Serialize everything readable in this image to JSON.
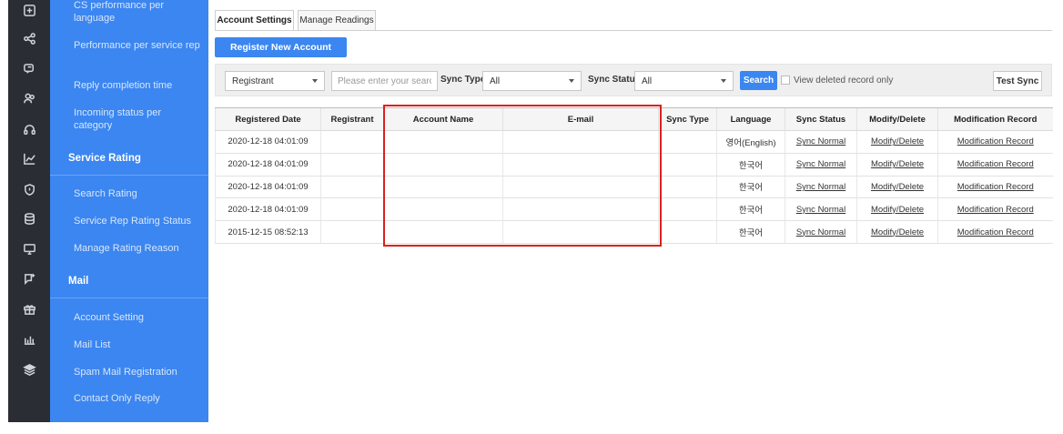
{
  "rail": {
    "icons": [
      "plus-square-icon",
      "share-icon",
      "chat-icon",
      "users-icon",
      "headset-icon",
      "line-chart-icon",
      "shield-icon",
      "database-icon",
      "monitor-icon",
      "message-plus-icon",
      "gift-icon",
      "bar-chart-icon",
      "layers-icon"
    ]
  },
  "menu": {
    "items": {
      "cs_language": "CS performance per language",
      "per_rep": "Performance per service rep",
      "reply_time": "Reply completion time",
      "incoming": "Incoming status per category",
      "service_rating_head": "Service Rating",
      "search_rating": "Search Rating",
      "rep_rating_status": "Service Rep Rating Status",
      "rating_reason": "Manage Rating Reason",
      "mail_head": "Mail",
      "account_setting": "Account Setting",
      "mail_list": "Mail List",
      "spam_registration": "Spam Mail Registration",
      "contact_reply": "Contact Only Reply"
    }
  },
  "tabs": [
    "Account Settings",
    "Manage Readings"
  ],
  "toolbar": {
    "register_label": "Register New Account"
  },
  "filters": {
    "registrant_select": "Registrant",
    "search_placeholder": "Please enter your search",
    "sync_type_label": "Sync Type",
    "sync_type_value": "All",
    "sync_status_label": "Sync Status",
    "sync_status_value": "All",
    "search_button": "Search",
    "deleted_only_label": "View deleted record only",
    "test_sync_button": "Test Sync"
  },
  "table": {
    "headers": [
      "Registered Date",
      "Registrant",
      "Account Name",
      "E-mail",
      "Sync Type",
      "Language",
      "Sync Status",
      "Modify/Delete",
      "Modification Record"
    ],
    "rows": [
      {
        "date": "2020-12-18 04:01:09",
        "registrant": "",
        "account": "",
        "email": "",
        "sync_type": "",
        "language": "영어(English)",
        "sync_status": "Sync Normal",
        "modify": "Modify/Delete",
        "record": "Modification Record"
      },
      {
        "date": "2020-12-18 04:01:09",
        "registrant": "",
        "account": "",
        "email": "",
        "sync_type": "",
        "language": "한국어",
        "sync_status": "Sync Normal",
        "modify": "Modify/Delete",
        "record": "Modification Record"
      },
      {
        "date": "2020-12-18 04:01:09",
        "registrant": "",
        "account": "",
        "email": "",
        "sync_type": "",
        "language": "한국어",
        "sync_status": "Sync Normal",
        "modify": "Modify/Delete",
        "record": "Modification Record"
      },
      {
        "date": "2020-12-18 04:01:09",
        "registrant": "",
        "account": "",
        "email": "",
        "sync_type": "",
        "language": "한국어",
        "sync_status": "Sync Normal",
        "modify": "Modify/Delete",
        "record": "Modification Record"
      },
      {
        "date": "2015-12-15 08:52:13",
        "registrant": "",
        "account": "",
        "email": "",
        "sync_type": "",
        "language": "한국어",
        "sync_status": "Sync Normal",
        "modify": "Modify/Delete",
        "record": "Modification Record"
      }
    ]
  },
  "colors": {
    "accent": "#3b86f0",
    "rail": "#2a2d33",
    "highlight": "#d9211e"
  }
}
